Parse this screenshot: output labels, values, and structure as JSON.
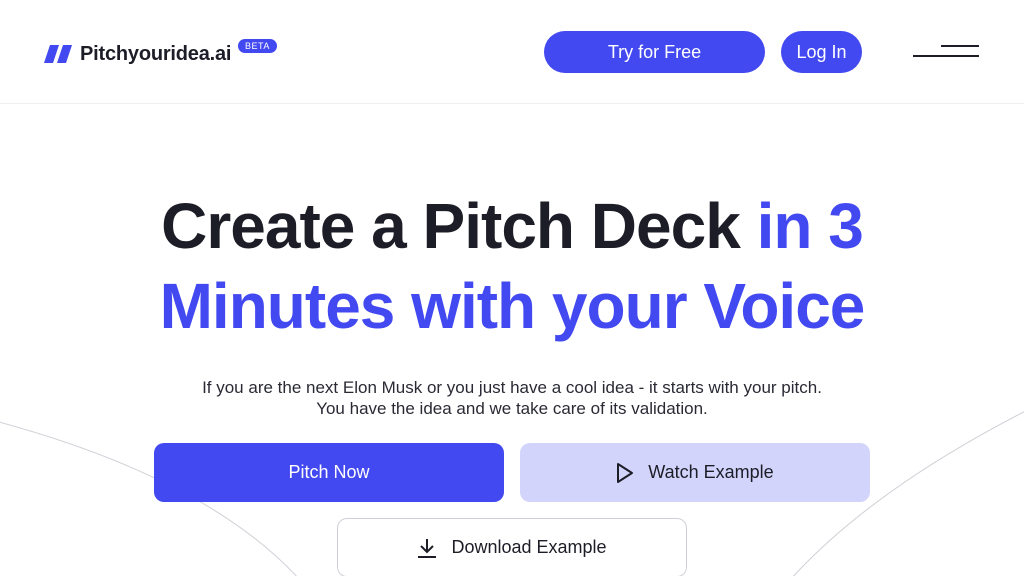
{
  "header": {
    "logo_text": "Pitchyouridea.ai",
    "beta_badge": "BETA",
    "try_free_label": "Try for Free",
    "login_label": "Log In",
    "accent_color": "#4349f0"
  },
  "hero": {
    "title_part1": "Create a Pitch Deck ",
    "title_part2": "in 3",
    "title_line2": "Minutes with your Voice",
    "subtitle_line1": "If you are the next Elon Musk or you just have a cool idea - it starts with your pitch.",
    "subtitle_line2": "You have the idea and we take care of its validation."
  },
  "actions": {
    "pitch_now": "Pitch Now",
    "watch_example": "Watch Example",
    "download_example": "Download Example"
  },
  "icons": {
    "logo": "logo-slash-mark-icon",
    "menu": "hamburger-menu-icon",
    "play": "play-icon",
    "download": "download-icon"
  }
}
